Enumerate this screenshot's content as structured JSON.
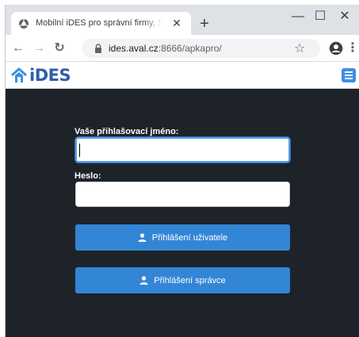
{
  "browser": {
    "tab_title": "Mobilní iDES pro správní firmy, S",
    "url_host": "ides.aval.cz",
    "url_rest": ":8666/apkapro/",
    "controls": {
      "close_tab": "✕",
      "new_tab": "+",
      "minimize": "—",
      "maximize": "☐",
      "close": "✕",
      "back": "←",
      "forward": "→",
      "reload": "↻",
      "bookmark": "☆",
      "menu": "⋮"
    }
  },
  "app": {
    "logo_text": "iDES"
  },
  "login": {
    "username_label": "Vaše přihlašovací jméno:",
    "username_value": "",
    "password_label": "Heslo:",
    "password_value": "",
    "user_login_button": "Přihlášení uživatele",
    "admin_login_button": "Přihlášení správce"
  },
  "colors": {
    "background": "#1e2329",
    "button": "#3386d5",
    "logo": "#2f5fa8",
    "focus_border": "#5aa0e6"
  },
  "icons": [
    "globe-icon",
    "lock-icon",
    "star-icon",
    "profile-icon",
    "home-icon",
    "hamburger-icon",
    "user-icon"
  ]
}
